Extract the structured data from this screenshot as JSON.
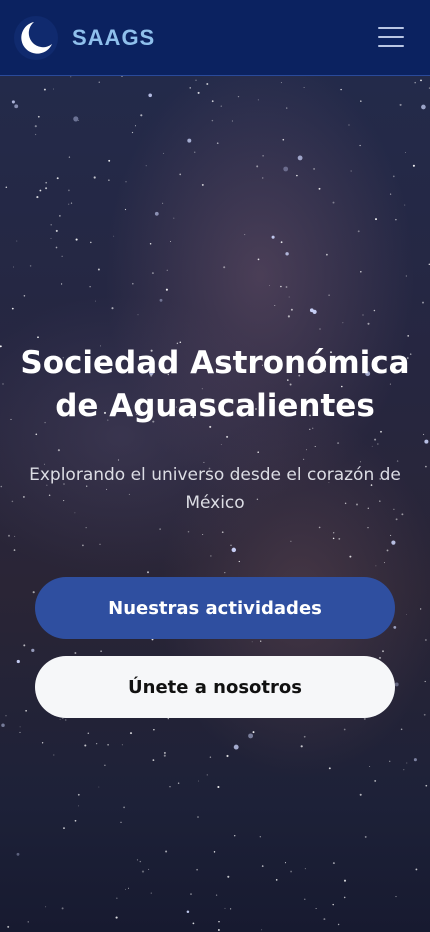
{
  "header": {
    "brand": "SAAGS",
    "logo_icon": "crescent-moon-icon",
    "menu_icon": "hamburger-menu-icon"
  },
  "hero": {
    "title": "Sociedad Astronómica de Aguascalientes",
    "subtitle": "Explorando el universo desde el corazón de México",
    "primary_button": "Nuestras actividades",
    "secondary_button": "Únete a nosotros"
  },
  "colors": {
    "header_bg": "#0b2260",
    "brand_text": "#8fc0ec",
    "primary_button": "#2f4fa0",
    "secondary_button": "#f6f7f9"
  }
}
